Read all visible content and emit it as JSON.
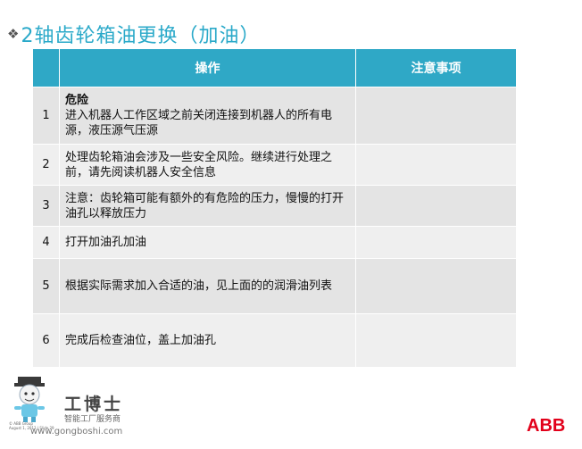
{
  "title": "2轴齿轮箱油更换（加油）",
  "table": {
    "headers": {
      "num": "",
      "operation": "操作",
      "notes": "注意事项"
    },
    "rows": [
      {
        "num": "1",
        "strong": "危险",
        "text": "进入机器人工作区域之前关闭连接到机器人的所有电源，液压源气压源",
        "note": ""
      },
      {
        "num": "2",
        "strong": "",
        "text": "处理齿轮箱油会涉及一些安全风险。继续进行处理之前，请先阅读机器人安全信息",
        "note": ""
      },
      {
        "num": "3",
        "strong": "",
        "text": "注意：齿轮箱可能有额外的有危险的压力，慢慢的打开油孔以释放压力",
        "note": ""
      },
      {
        "num": "4",
        "strong": "",
        "text": "打开加油孔加油",
        "note": ""
      },
      {
        "num": "5",
        "strong": "",
        "text": "根据实际需求加入合适的油，见上面的的润滑油列表",
        "note": ""
      },
      {
        "num": "6",
        "strong": "",
        "text": "完成后检查油位，盖上加油孔",
        "note": ""
      }
    ]
  },
  "footer": {
    "brand_name": "工博士",
    "brand_sub": "智能工厂服务商",
    "brand_url": "www.gongboshi.com",
    "abb_small_1": "© ABB Group",
    "abb_small_2": "August 1, 2012 | Slide 29",
    "abb_logo": "ABB"
  }
}
